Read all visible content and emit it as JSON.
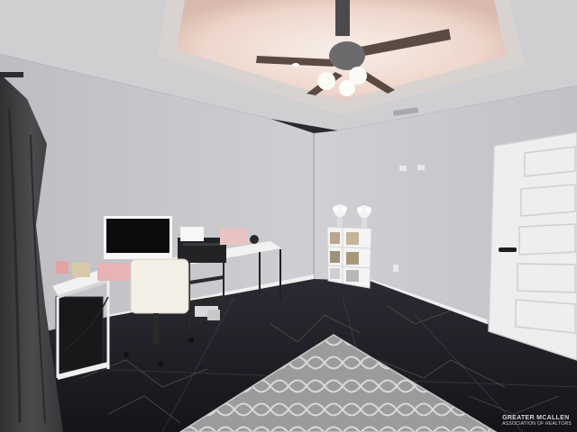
{
  "watermark": {
    "brand": "GREATER MCALLEN",
    "sub": "ASSOCIATION OF REALTORS"
  },
  "colors": {
    "wall_left": "#cbcbcf",
    "wall_right": "#c6c7cb",
    "ceiling": "#d2d2d4",
    "tray_glow": "#f1d4c8",
    "floor": "#1d1d24",
    "door": "#eeeeee",
    "curtain": "#3d3f40",
    "desk_top": "#f2f2f2",
    "rug": "#9a9a9a",
    "pink_accent": "#e7b3b5"
  },
  "icons": [
    "ceiling-fan-icon",
    "printer-icon",
    "monitor-icon",
    "office-chair-icon",
    "door-icon",
    "shelf-icon",
    "flower-vase-icon"
  ]
}
